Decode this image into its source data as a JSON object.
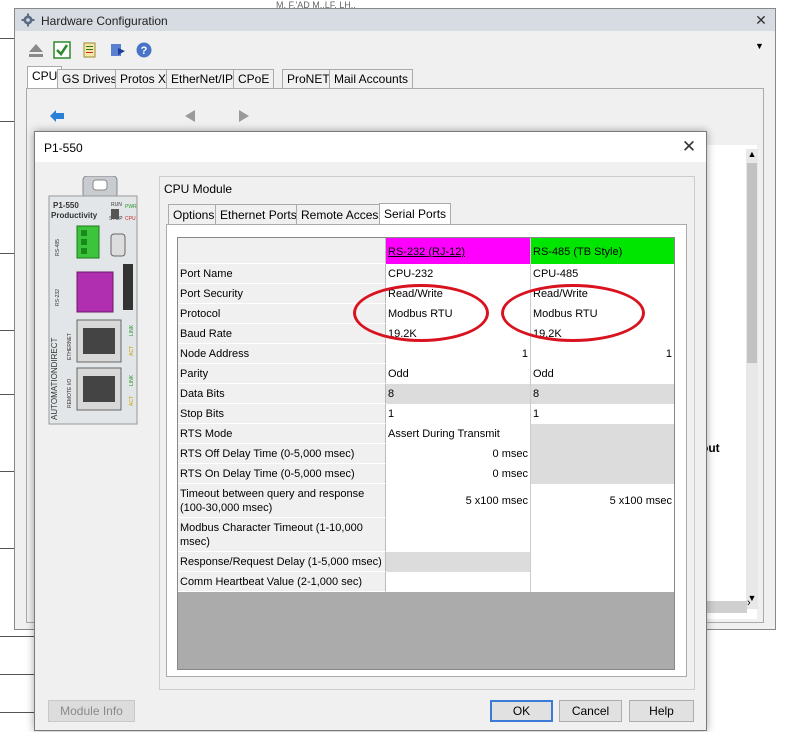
{
  "outer_window": {
    "title": "Hardware Configuration",
    "tabs": [
      "CPU",
      "GS Drives",
      "Protos X",
      "EtherNet/IP",
      "CPoE",
      "ProNET",
      "Mail Accounts"
    ],
    "background_fragment": "out",
    "top_fragment": "M. F.'AD M..LF. LH.."
  },
  "dialog": {
    "title": "P1-550",
    "group_label": "CPU Module",
    "tabs": [
      "Options",
      "Ethernet Ports",
      "Remote Access",
      "Serial Ports"
    ],
    "active_tab": "Serial Ports",
    "columns": [
      {
        "label": "RS-232 (RJ-12)",
        "color": "#ff00ff"
      },
      {
        "label": "RS-485 (TB Style)",
        "color": "#00e600"
      }
    ],
    "rows": [
      {
        "label": "Port Name",
        "a": "CPU-232",
        "b": "CPU-485"
      },
      {
        "label": "Port Security",
        "a": "Read/Write",
        "b": "Read/Write"
      },
      {
        "label": "Protocol",
        "a": "Modbus RTU",
        "b": "Modbus RTU"
      },
      {
        "label": "Baud Rate",
        "a": "19.2K",
        "b": "19.2K"
      },
      {
        "label": "Node Address",
        "a": "1",
        "b": "1"
      },
      {
        "label": "Parity",
        "a": "Odd",
        "b": "Odd"
      },
      {
        "label": "Data Bits",
        "a": "8",
        "b": "8"
      },
      {
        "label": "Stop Bits",
        "a": "1",
        "b": "1"
      },
      {
        "label": "RTS Mode",
        "a": "Assert During Transmit",
        "b": ""
      },
      {
        "label": "RTS Off Delay Time (0-5,000 msec)",
        "a": "0  msec",
        "b": ""
      },
      {
        "label": "RTS On Delay Time (0-5,000 msec)",
        "a": "0  msec",
        "b": ""
      },
      {
        "label": "Timeout between query and response (100-30,000 msec)",
        "a": "5  x100 msec",
        "b": "5  x100 msec"
      },
      {
        "label": "Modbus Character Timeout (1-10,000 msec)",
        "a": "",
        "b": ""
      },
      {
        "label": "Response/Request Delay (1-5,000 msec)",
        "a": "",
        "b": ""
      },
      {
        "label": "Comm Heartbeat Value (2-1,000 sec)",
        "a": "",
        "b": ""
      }
    ],
    "buttons": {
      "module_info": "Module Info",
      "ok": "OK",
      "cancel": "Cancel",
      "help": "Help"
    },
    "device": {
      "model": "P1-550",
      "brand": "Productivity",
      "brand_vertical": "AUTOMATIONDIRECT",
      "leds": [
        "RUN",
        "PWR",
        "STOP",
        "CPU"
      ],
      "port_labels": [
        "RS-485",
        "RS-232",
        "ETHERNET",
        "REMOTE I/O"
      ],
      "link_labels": [
        "LINK",
        "ACT",
        "LINK",
        "ACT"
      ]
    }
  },
  "annotation": {
    "color": "#d9121f"
  }
}
